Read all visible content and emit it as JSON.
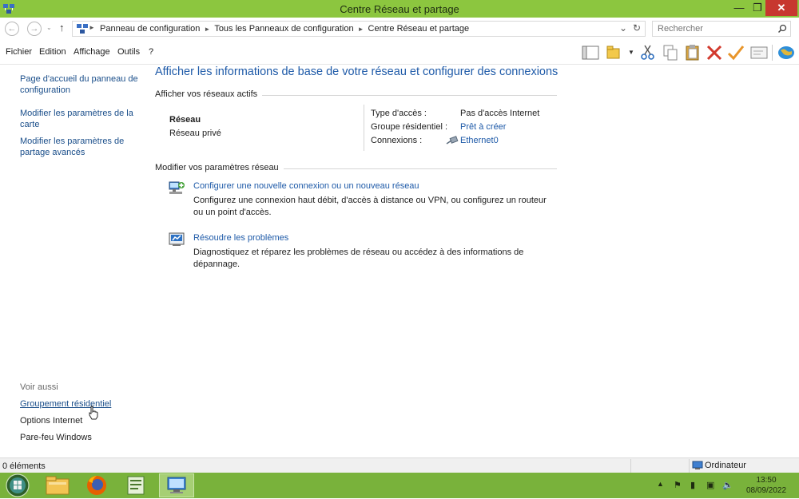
{
  "window": {
    "title": "Centre Réseau et partage",
    "min_glyph": "—",
    "max_glyph": "❐",
    "close_glyph": "✕"
  },
  "address": {
    "crumbs": [
      "Panneau de configuration",
      "Tous les Panneaux de configuration",
      "Centre Réseau et partage"
    ],
    "search_placeholder": "Rechercher"
  },
  "menu": {
    "file": "Fichier",
    "edit": "Edition",
    "view": "Affichage",
    "tools": "Outils",
    "help": "?"
  },
  "left_pane": {
    "links": [
      "Page d'accueil du panneau de configuration",
      "Modifier les paramètres de la carte",
      "Modifier les paramètres de partage avancés"
    ],
    "see_also_heading": "Voir aussi",
    "see_also": [
      "Groupement résidentiel",
      "Options Internet",
      "Pare-feu Windows"
    ]
  },
  "main": {
    "title": "Afficher les informations de base de votre réseau et configurer des connexions",
    "active_networks_heading": "Afficher vos réseaux actifs",
    "network": {
      "name": "Réseau",
      "type": "Réseau privé",
      "access_type_label": "Type d'accès :",
      "access_type_value": "Pas d'accès Internet",
      "homegroup_label": "Groupe résidentiel :",
      "homegroup_value": "Prêt à créer",
      "connections_label": "Connexions :",
      "connections_value": "Ethernet0"
    },
    "change_settings_heading": "Modifier vos paramètres réseau",
    "tasks": [
      {
        "title": "Configurer une nouvelle connexion ou un nouveau réseau",
        "description": "Configurez une connexion haut débit, d'accès à distance ou VPN, ou configurez un routeur ou un point d'accès."
      },
      {
        "title": "Résoudre les problèmes",
        "description": "Diagnostiquez et réparez les problèmes de réseau ou accédez à des informations de dépannage."
      }
    ]
  },
  "statusbar": {
    "items_count": "0 éléments",
    "location": "Ordinateur"
  },
  "taskbar": {
    "time": "13:50",
    "date": "08/09/2022"
  },
  "colors": {
    "titlebar": "#8cc63f",
    "taskbar": "#79b23b",
    "link": "#1e5aa8",
    "close": "#c7372f"
  },
  "icons": [
    "network-app-icon",
    "back-icon",
    "forward-icon",
    "up-icon",
    "refresh-icon",
    "search-icon",
    "cut-icon",
    "copy-icon",
    "paste-icon",
    "delete-icon",
    "check-icon",
    "properties-icon",
    "globe-icon",
    "ethernet-icon",
    "new-connection-icon",
    "troubleshoot-icon",
    "computer-icon",
    "start-orb-icon",
    "explorer-icon",
    "firefox-icon",
    "notepad-icon",
    "control-panel-icon"
  ]
}
